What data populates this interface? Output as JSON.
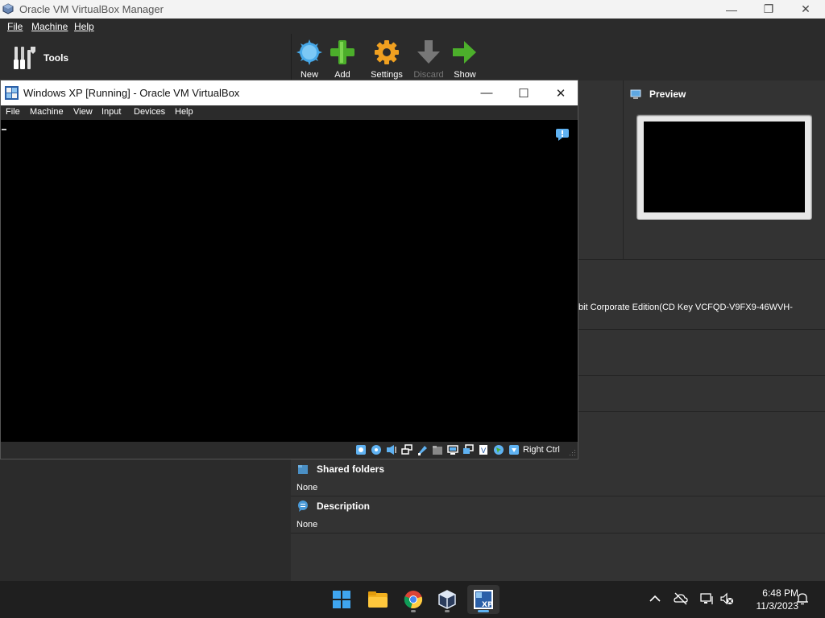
{
  "manager": {
    "title": "Oracle VM VirtualBox Manager",
    "controls": {
      "minimize": "—",
      "maximize": "❐",
      "close": "✕"
    },
    "menu": [
      {
        "label": "File"
      },
      {
        "label": "Machine"
      },
      {
        "label": "Help"
      }
    ],
    "tools_label": "Tools",
    "toolbar": {
      "new": "New",
      "add": "Add",
      "settings": "Settings",
      "discard": "Discard",
      "show": "Show"
    },
    "preview_title": "Preview",
    "os_text": "bit Corporate Edition(CD Key VCFQD-V9FX9-46WVH-",
    "shared_folders": {
      "title": "Shared folders",
      "value": "None"
    },
    "description": {
      "title": "Description",
      "value": "None"
    }
  },
  "vm_window": {
    "title": "Windows XP [Running] - Oracle VM VirtualBox",
    "controls": {
      "minimize": "—",
      "maximize": "☐",
      "close": "✕"
    },
    "menu": [
      {
        "label": "File"
      },
      {
        "label": "Machine"
      },
      {
        "label": "View"
      },
      {
        "label": "Input"
      },
      {
        "label": "Devices"
      },
      {
        "label": "Help"
      }
    ],
    "host_key": "Right Ctrl",
    "status_icons": [
      "hard-disk-icon",
      "optical-drive-icon",
      "audio-icon",
      "network-icon",
      "usb-icon",
      "shared-folders-icon",
      "display-icon",
      "video-capture-icon",
      "virtualization-icon",
      "mouse-integration-icon",
      "keyboard-icon"
    ]
  },
  "taskbar": {
    "apps": [
      "windows-start-icon",
      "file-explorer-icon",
      "chrome-icon",
      "virtualbox-icon",
      "windows-xp-vm-icon"
    ],
    "time": "6:48 PM",
    "date": "11/3/2023"
  },
  "colors": {
    "accent_blue": "#5fb2f2",
    "toolbar_green": "#4caf2b",
    "settings_orange": "#f0a020"
  }
}
